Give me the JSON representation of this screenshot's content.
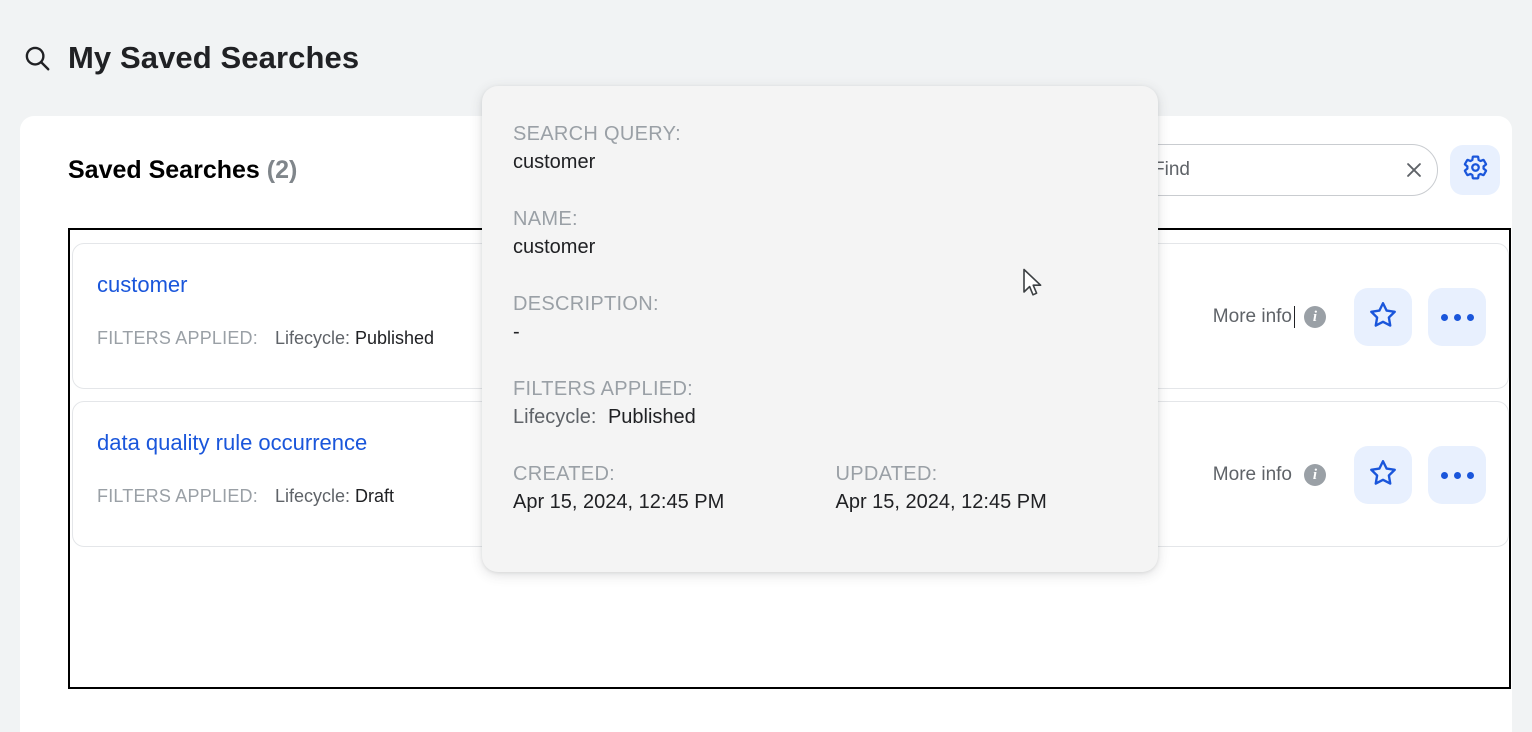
{
  "header": {
    "icon": "search-icon",
    "title": "My Saved Searches"
  },
  "card": {
    "section_title": "Saved Searches",
    "section_count": "(2)",
    "find": {
      "value": "",
      "placeholder": "Find",
      "clear_icon": "close-icon"
    },
    "settings_icon": "gear-icon"
  },
  "rows": [
    {
      "title": "customer",
      "filters_label": "FILTERS APPLIED:",
      "filter_key": "Lifecycle:",
      "filter_value": "Published",
      "more_info_label": "More info",
      "info_icon": "info-icon",
      "favorite_icon": "star-icon",
      "overflow_icon": "ellipsis-icon"
    },
    {
      "title": "data quality rule occurrence",
      "filters_label": "FILTERS APPLIED:",
      "filter_key": "Lifecycle:",
      "filter_value": "Draft",
      "more_info_label": "More info",
      "info_icon": "info-icon",
      "favorite_icon": "star-icon",
      "overflow_icon": "ellipsis-icon"
    }
  ],
  "tooltip": {
    "search_query_label": "SEARCH QUERY:",
    "search_query_value": "customer",
    "name_label": "NAME:",
    "name_value": "customer",
    "description_label": "DESCRIPTION:",
    "description_value": "-",
    "filters_label": "FILTERS APPLIED:",
    "filter_key": "Lifecycle:",
    "filter_value": "Published",
    "created_label": "CREATED:",
    "created_value": "Apr 15, 2024, 12:45 PM",
    "updated_label": "UPDATED:",
    "updated_value": "Apr 15, 2024, 12:45 PM"
  },
  "colors": {
    "page_background": "#f1f3f4",
    "card_background": "#ffffff",
    "link_blue": "#1a56db",
    "accent_button_background": "#e8f0fe",
    "tooltip_background": "#f4f4f4",
    "muted_text": "#9aa0a6",
    "primary_text": "#202124"
  }
}
